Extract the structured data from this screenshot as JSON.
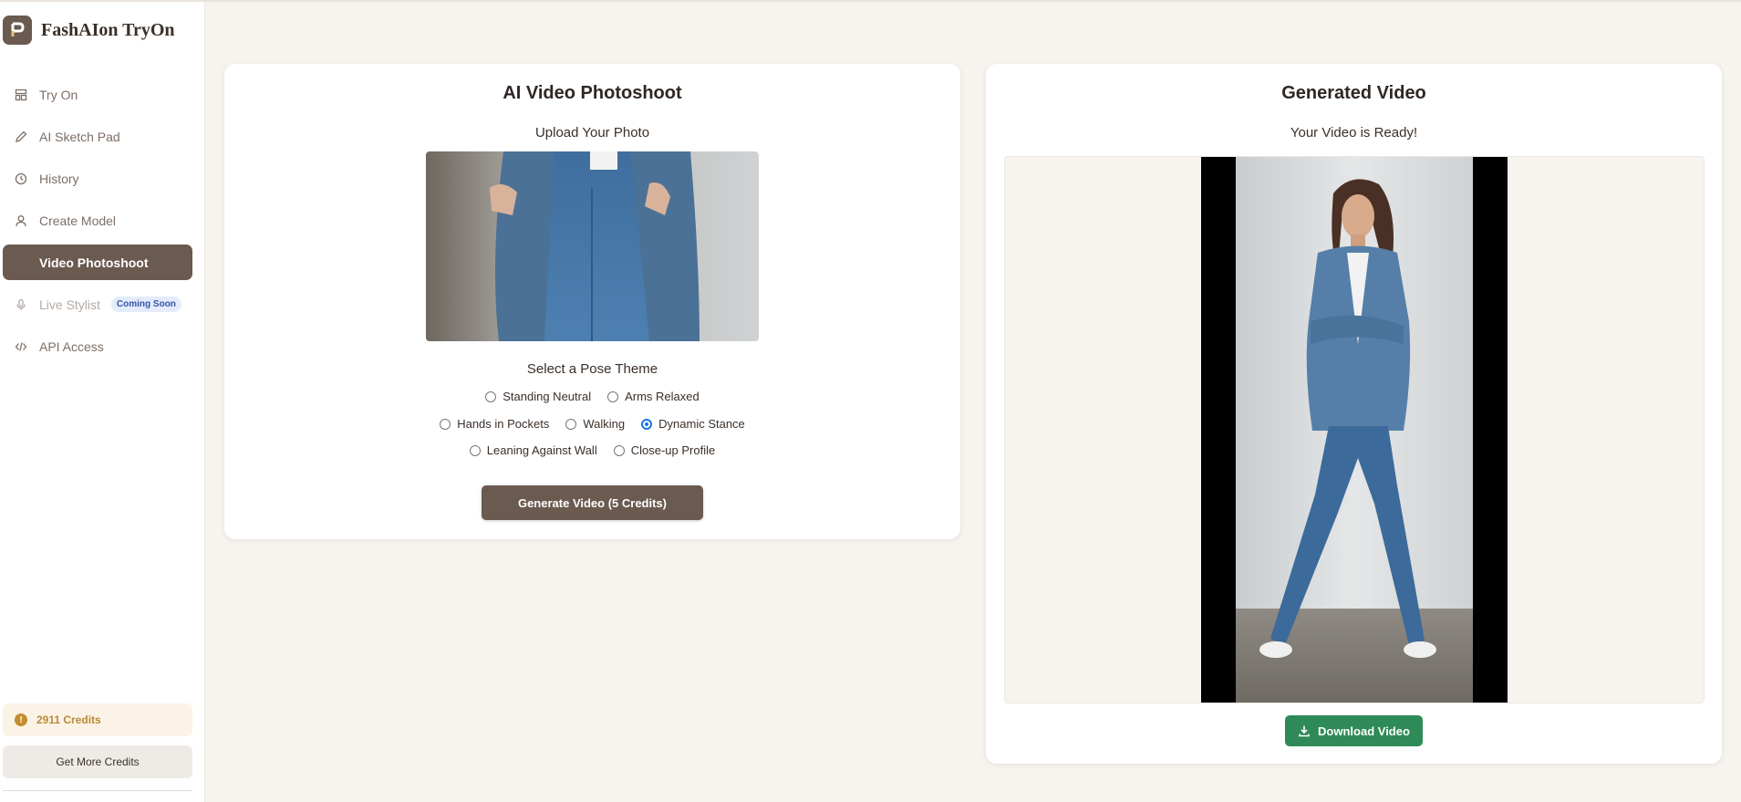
{
  "app": {
    "name": "FashAIon TryOn"
  },
  "sidebar": {
    "items": [
      {
        "label": "Try On",
        "icon": "layout-icon"
      },
      {
        "label": "AI Sketch Pad",
        "icon": "pencil-icon"
      },
      {
        "label": "History",
        "icon": "clock-icon"
      },
      {
        "label": "Create Model",
        "icon": "user-icon"
      },
      {
        "label": "Video Photoshoot",
        "icon": "video-icon",
        "active": true
      },
      {
        "label": "Live Stylist",
        "icon": "mic-icon",
        "badge": "Coming Soon",
        "disabled": true
      },
      {
        "label": "API Access",
        "icon": "code-icon"
      }
    ],
    "credits": "2911 Credits",
    "get_more": "Get More Credits"
  },
  "left_card": {
    "title": "AI Video Photoshoot",
    "upload_label": "Upload Your Photo",
    "pose_label": "Select a Pose Theme",
    "poses": [
      {
        "label": "Standing Neutral",
        "checked": false
      },
      {
        "label": "Arms Relaxed",
        "checked": false
      },
      {
        "label": "Hands in Pockets",
        "checked": false
      },
      {
        "label": "Walking",
        "checked": false
      },
      {
        "label": "Dynamic Stance",
        "checked": true
      },
      {
        "label": "Leaning Against Wall",
        "checked": false
      },
      {
        "label": "Close-up Profile",
        "checked": false
      }
    ],
    "generate_button": "Generate Video (5 Credits)"
  },
  "right_card": {
    "title": "Generated Video",
    "status": "Your Video is Ready!",
    "download_button": "Download Video"
  },
  "colors": {
    "accent": "#6b5a4f",
    "download_green": "#2e8a57",
    "background": "#f7f4ef",
    "radio_selected": "#1a73e8"
  }
}
